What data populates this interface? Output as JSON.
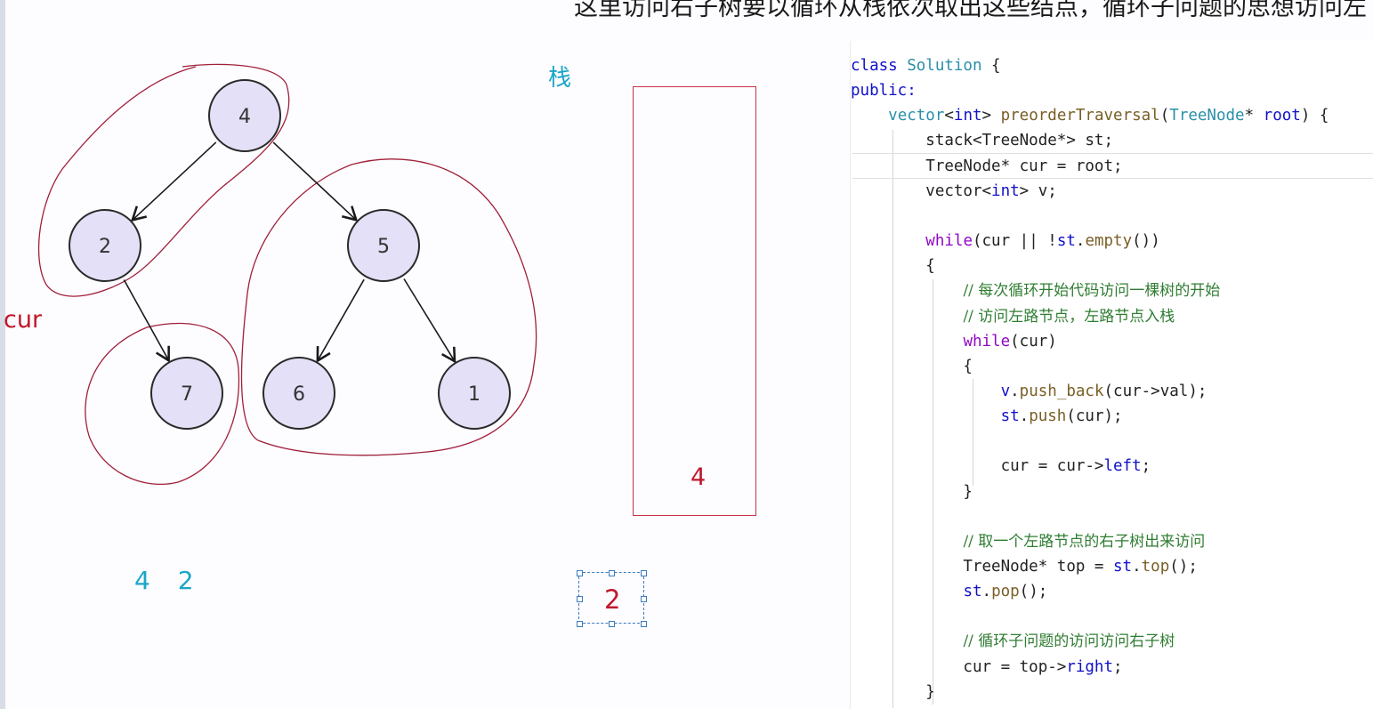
{
  "caption": "这里访问右子树要以循环从栈依次取出这些结点，循环子问题的思想访问左",
  "tree": {
    "nodes": [
      {
        "id": "n4",
        "label": "4"
      },
      {
        "id": "n2",
        "label": "2"
      },
      {
        "id": "n5",
        "label": "5"
      },
      {
        "id": "n7",
        "label": "7"
      },
      {
        "id": "n6",
        "label": "6"
      },
      {
        "id": "n1",
        "label": "1"
      }
    ],
    "edges": [
      [
        "n4",
        "n2"
      ],
      [
        "n4",
        "n5"
      ],
      [
        "n2",
        "n7"
      ],
      [
        "n5",
        "n6"
      ],
      [
        "n5",
        "n1"
      ]
    ],
    "colors": {
      "node_fill": "#e4e0f7",
      "node_stroke": "#2a2a2a",
      "outline": "#a0203a"
    }
  },
  "cur_label": "cur",
  "stack": {
    "title": "栈",
    "items": [
      "4"
    ]
  },
  "visit_order": "4 2",
  "selected_text": "2",
  "code": {
    "lines": [
      [
        {
          "t": "class ",
          "c": "kw"
        },
        {
          "t": "Solution",
          "c": "ty"
        },
        {
          "t": " {",
          "c": ""
        }
      ],
      [
        {
          "t": "public:",
          "c": "kw"
        }
      ],
      [
        {
          "t": "    ",
          "c": ""
        },
        {
          "t": "vector",
          "c": "ty"
        },
        {
          "t": "<",
          "c": ""
        },
        {
          "t": "int",
          "c": "kw"
        },
        {
          "t": "> ",
          "c": ""
        },
        {
          "t": "preorderTraversal",
          "c": "fn"
        },
        {
          "t": "(",
          "c": ""
        },
        {
          "t": "TreeNode",
          "c": "ty"
        },
        {
          "t": "* ",
          "c": ""
        },
        {
          "t": "root",
          "c": "kw"
        },
        {
          "t": ") {",
          "c": ""
        }
      ],
      [
        {
          "t": "        stack<TreeNode*> st;",
          "c": ""
        }
      ],
      [
        {
          "t": "        TreeNode* cur = root;",
          "c": ""
        }
      ],
      [
        {
          "t": "        vector<",
          "c": ""
        },
        {
          "t": "int",
          "c": "kw"
        },
        {
          "t": "> v;",
          "c": ""
        }
      ],
      [
        {
          "t": "",
          "c": ""
        }
      ],
      [
        {
          "t": "        ",
          "c": ""
        },
        {
          "t": "while",
          "c": "ctl"
        },
        {
          "t": "(cur || !",
          "c": ""
        },
        {
          "t": "st",
          "c": "kw"
        },
        {
          "t": ".",
          "c": ""
        },
        {
          "t": "empty",
          "c": "fn"
        },
        {
          "t": "())",
          "c": ""
        }
      ],
      [
        {
          "t": "        {",
          "c": ""
        }
      ],
      [
        {
          "t": "            ",
          "c": ""
        },
        {
          "t": "// 每次循环开始代码访问一棵树的开始",
          "c": "cm"
        }
      ],
      [
        {
          "t": "            ",
          "c": ""
        },
        {
          "t": "// 访问左路节点，左路节点入栈",
          "c": "cm"
        }
      ],
      [
        {
          "t": "            ",
          "c": ""
        },
        {
          "t": "while",
          "c": "ctl"
        },
        {
          "t": "(cur)",
          "c": ""
        }
      ],
      [
        {
          "t": "            {",
          "c": ""
        }
      ],
      [
        {
          "t": "                ",
          "c": ""
        },
        {
          "t": "v",
          "c": "kw"
        },
        {
          "t": ".",
          "c": ""
        },
        {
          "t": "push_back",
          "c": "fn"
        },
        {
          "t": "(cur->val);",
          "c": ""
        }
      ],
      [
        {
          "t": "                ",
          "c": ""
        },
        {
          "t": "st",
          "c": "kw"
        },
        {
          "t": ".",
          "c": ""
        },
        {
          "t": "push",
          "c": "fn"
        },
        {
          "t": "(cur);",
          "c": ""
        }
      ],
      [
        {
          "t": "",
          "c": ""
        }
      ],
      [
        {
          "t": "                cur = cur->",
          "c": ""
        },
        {
          "t": "left",
          "c": "kw"
        },
        {
          "t": ";",
          "c": ""
        }
      ],
      [
        {
          "t": "            }",
          "c": ""
        }
      ],
      [
        {
          "t": "",
          "c": ""
        }
      ],
      [
        {
          "t": "            ",
          "c": ""
        },
        {
          "t": "// 取一个左路节点的右子树出来访问",
          "c": "cm"
        }
      ],
      [
        {
          "t": "            TreeNode* top = ",
          "c": ""
        },
        {
          "t": "st",
          "c": "kw"
        },
        {
          "t": ".",
          "c": ""
        },
        {
          "t": "top",
          "c": "fn"
        },
        {
          "t": "();",
          "c": ""
        }
      ],
      [
        {
          "t": "            ",
          "c": ""
        },
        {
          "t": "st",
          "c": "kw"
        },
        {
          "t": ".",
          "c": ""
        },
        {
          "t": "pop",
          "c": "fn"
        },
        {
          "t": "();",
          "c": ""
        }
      ],
      [
        {
          "t": "",
          "c": ""
        }
      ],
      [
        {
          "t": "            ",
          "c": ""
        },
        {
          "t": "// 循环子问题的访问访问右子树",
          "c": "cm"
        }
      ],
      [
        {
          "t": "            cur = top->",
          "c": ""
        },
        {
          "t": "right",
          "c": "kw"
        },
        {
          "t": ";",
          "c": ""
        }
      ],
      [
        {
          "t": "        }",
          "c": ""
        }
      ]
    ]
  }
}
